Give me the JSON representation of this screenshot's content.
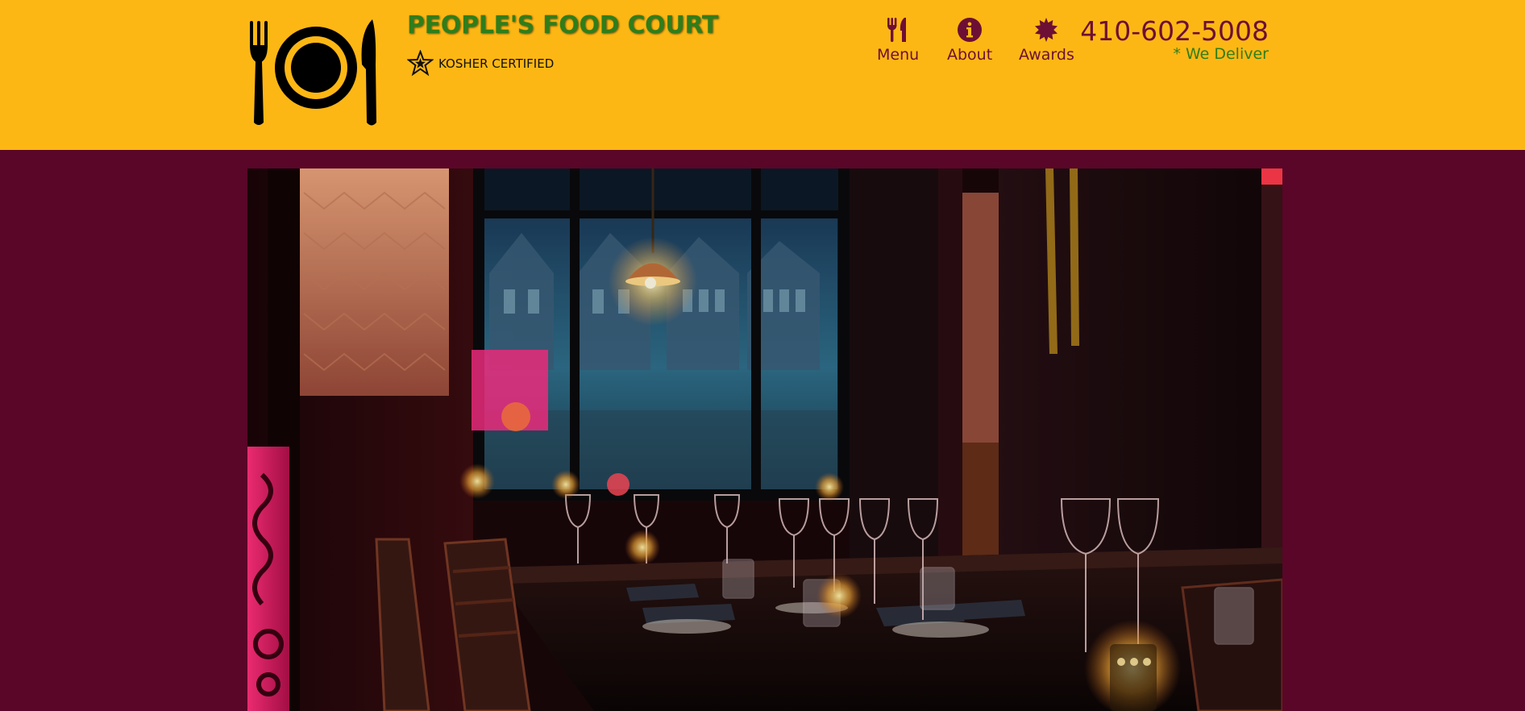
{
  "header": {
    "logo_icon": "plate-fork-knife-icon",
    "title": "PEOPLE'S FOOD COURT",
    "badge": {
      "icon": "star-icon",
      "label": "KOSHER CERTIFIED"
    },
    "nav": [
      {
        "label": "Menu",
        "icon": "utensils-icon"
      },
      {
        "label": "About",
        "icon": "info-circle-icon"
      },
      {
        "label": "Awards",
        "icon": "award-burst-icon"
      }
    ],
    "phone": "410-602-5008",
    "delivery_note": "* We Deliver"
  },
  "hero": {
    "image": "restaurant-interior-photo"
  },
  "colors": {
    "header_bg": "#fdb714",
    "page_bg": "#5a0628",
    "title": "#2f7d1b",
    "nav_text": "#6d0f34",
    "delivery_text": "#2f7d1b"
  }
}
